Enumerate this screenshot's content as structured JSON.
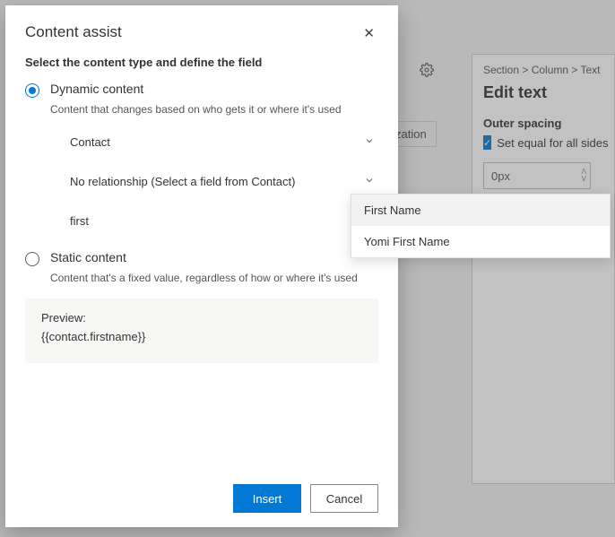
{
  "modal": {
    "title": "Content assist",
    "instruction": "Select the content type and define the field",
    "dynamic": {
      "label": "Dynamic content",
      "desc": "Content that changes based on who gets it or where it's used",
      "entity": "Contact",
      "relationship": "No relationship (Select a field from Contact)",
      "search": "first"
    },
    "static": {
      "label": "Static content",
      "desc": "Content that's a fixed value, regardless of how or where it's used"
    },
    "preview": {
      "label": "Preview:",
      "value": "{{contact.firstname}}"
    },
    "buttons": {
      "insert": "Insert",
      "cancel": "Cancel"
    },
    "close_label": "✕"
  },
  "autocomplete": {
    "items": [
      "First Name",
      "Yomi First Name"
    ]
  },
  "right": {
    "crumbs": "Section > Column > Text",
    "title": "Edit text",
    "spacing_label": "Outer spacing",
    "checkbox": "Set equal for all sides",
    "spacing_value": "0px"
  },
  "bg": {
    "fragment": "zation"
  }
}
